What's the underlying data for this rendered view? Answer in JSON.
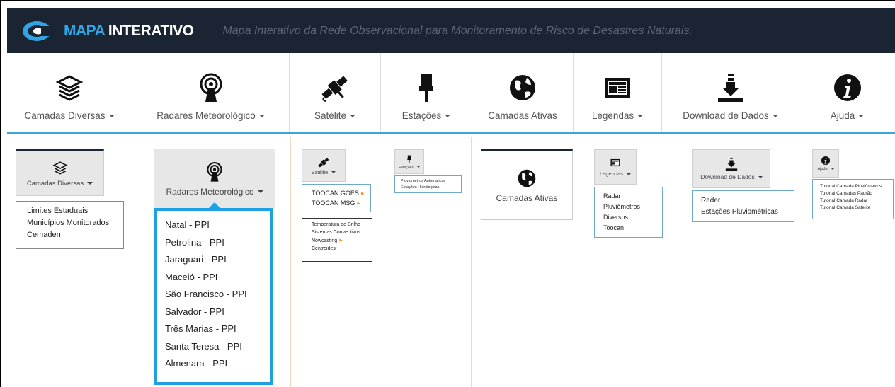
{
  "header": {
    "brand_accent": "MAPA",
    "brand_rest": " INTERATIVO",
    "tagline": "Mapa Interativo da Rede Observacional para Monitoramento de Risco de Desastres Naturais."
  },
  "nav": {
    "items": [
      {
        "label": "Camadas Diversas",
        "icon": "layers-icon",
        "dropdown": true
      },
      {
        "label": "Radares Meteorológico",
        "icon": "radar-icon",
        "dropdown": true
      },
      {
        "label": "Satélite",
        "icon": "satellite-icon",
        "dropdown": true
      },
      {
        "label": "Estações",
        "icon": "station-icon",
        "dropdown": true
      },
      {
        "label": "Camadas Ativas",
        "icon": "globe-icon",
        "dropdown": false
      },
      {
        "label": "Legendas",
        "icon": "newspaper-icon",
        "dropdown": true
      },
      {
        "label": "Download de Dados",
        "icon": "download-icon",
        "dropdown": true
      },
      {
        "label": "Ajuda",
        "icon": "info-icon",
        "dropdown": true
      }
    ]
  },
  "panels": {
    "camadas": {
      "button": "Camadas Diversas",
      "items": [
        "Limites Estaduais",
        "Municípios Monitorados",
        "Cemaden"
      ]
    },
    "radares": {
      "button": "Radares Meteorológico",
      "items": [
        "Natal - PPI",
        "Petrolina - PPI",
        "Jaraguari - PPI",
        "Maceió - PPI",
        "São Francisco - PPI",
        "Salvador - PPI",
        "Três Marias - PPI",
        "Santa Teresa - PPI",
        "Almenara - PPI"
      ]
    },
    "satelite": {
      "button": "Satélite",
      "items": [
        "TOOCAN GOES",
        "TOOCAN MSG"
      ],
      "submenu": [
        "Temperatura de Brilho",
        "Sistemas Convectivos",
        "Nowcasting",
        "Centroides"
      ]
    },
    "estacoes": {
      "button": "Estações",
      "items": [
        "Pluviometros Automaticos",
        "Estações Hidrologicas"
      ]
    },
    "ativas": {
      "button": "Camadas Ativas"
    },
    "legendas": {
      "button": "Legendas",
      "items": [
        "Radar",
        "Pluviômetros",
        "Diversos",
        "Toocan"
      ]
    },
    "download": {
      "button": "Download de Dados",
      "items": [
        "Radar",
        "Estações Pluviométricas"
      ]
    },
    "ajuda": {
      "button": "Ajuda",
      "items": [
        "Tutorial Camada Pluviômetros",
        "Tutorial Camadas Padrão",
        "Tutorial Camada Radar",
        "Tutorial Camada Satelite"
      ]
    }
  },
  "colors": {
    "header_bg": "#1b2433",
    "accent": "#2ea6e6",
    "highlight_border": "#1da1e2"
  }
}
